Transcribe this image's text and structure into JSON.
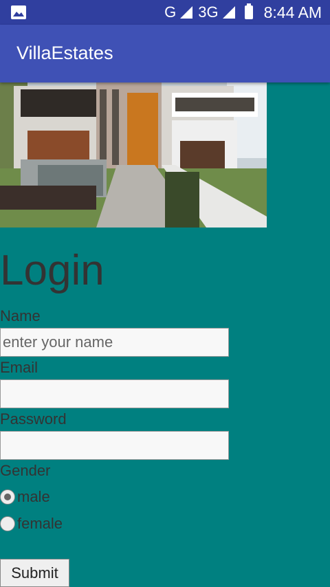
{
  "status_bar": {
    "network_type_1": "G",
    "network_type_2": "3G",
    "time": "8:44 AM",
    "icons": [
      "gallery-notification-icon",
      "signal-icon",
      "signal-icon",
      "battery-icon"
    ]
  },
  "app_bar": {
    "title": "VillaEstates"
  },
  "main": {
    "hero_image": "villa-house-image",
    "heading": "Login",
    "name_label": "Name",
    "name_placeholder": "enter your name",
    "email_label": "Email",
    "password_label": "Password",
    "gender_label": "Gender",
    "gender_options": [
      {
        "label": "male",
        "checked": true
      },
      {
        "label": "female",
        "checked": false
      }
    ],
    "submit_label": "Submit"
  },
  "colors": {
    "status_bar": "#303f9f",
    "app_bar": "#3f51b5",
    "background": "#008080",
    "text": "#333333"
  }
}
